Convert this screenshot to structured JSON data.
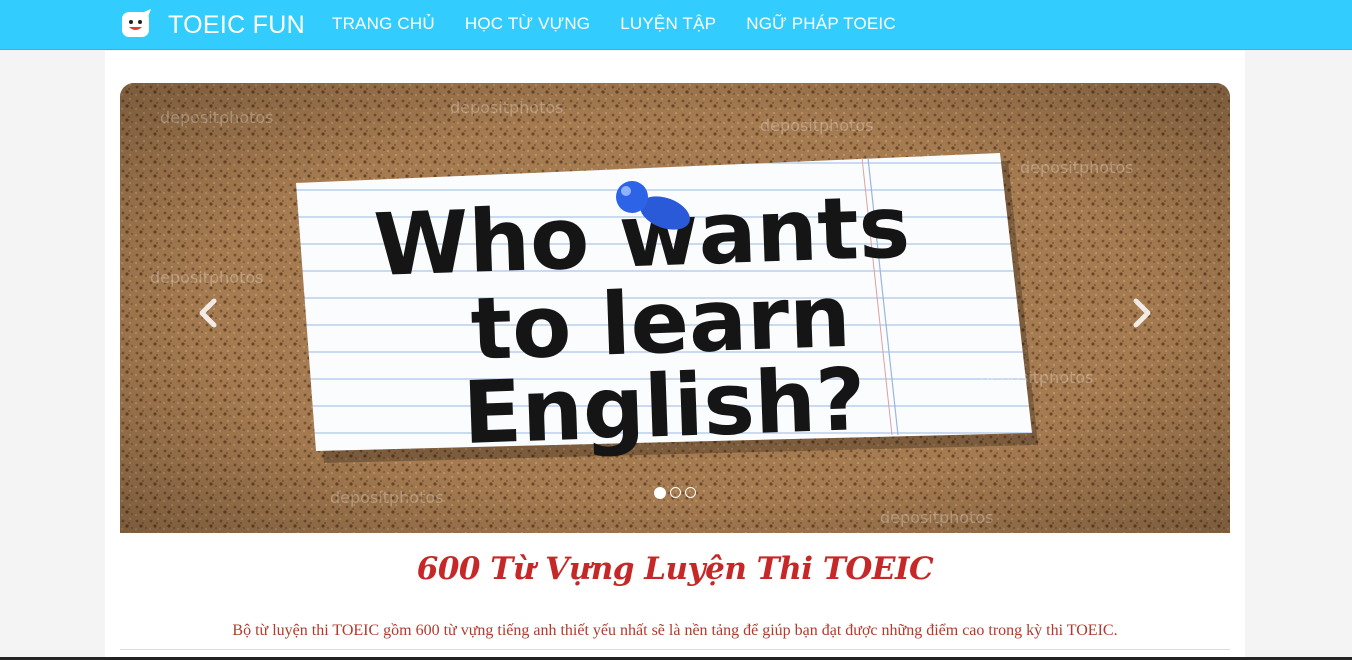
{
  "navbar": {
    "brand_name": "TOEIC FUN",
    "brand_icon": "smiley-chat-icon",
    "links": [
      {
        "label": "TRANG CHỦ"
      },
      {
        "label": "HỌC TỪ VỰNG"
      },
      {
        "label": "LUYỆN TẬP"
      },
      {
        "label": "NGỮ PHÁP TOEIC"
      }
    ]
  },
  "carousel": {
    "slide_text_lines": [
      "Who wants",
      "to learn",
      "English?"
    ],
    "watermark": "depositphotos",
    "prev_icon": "chevron-left-icon",
    "next_icon": "chevron-right-icon",
    "indicator_count": 3,
    "active_index": 0
  },
  "main": {
    "title": "600 Từ Vựng Luyện Thi TOEIC",
    "description": "Bộ từ luyện thi TOEIC gồm 600 từ vựng tiếng anh thiết yếu nhất sẽ là nền tảng để giúp bạn đạt được những điểm cao trong kỳ thi TOEIC."
  },
  "colors": {
    "navbar_bg": "#33ccff",
    "accent_red": "#c62828",
    "cork": "#a47a52"
  }
}
